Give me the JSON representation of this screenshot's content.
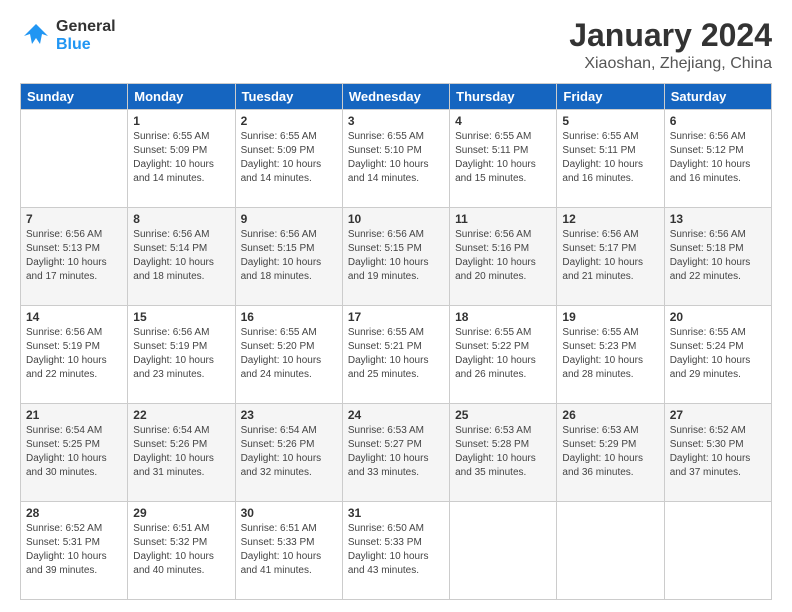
{
  "logo": {
    "general": "General",
    "blue": "Blue"
  },
  "header": {
    "title": "January 2024",
    "subtitle": "Xiaoshan, Zhejiang, China"
  },
  "weekdays": [
    "Sunday",
    "Monday",
    "Tuesday",
    "Wednesday",
    "Thursday",
    "Friday",
    "Saturday"
  ],
  "weeks": [
    [
      {
        "day": "",
        "sunrise": "",
        "sunset": "",
        "daylight": ""
      },
      {
        "day": "1",
        "sunrise": "Sunrise: 6:55 AM",
        "sunset": "Sunset: 5:09 PM",
        "daylight": "Daylight: 10 hours and 14 minutes."
      },
      {
        "day": "2",
        "sunrise": "Sunrise: 6:55 AM",
        "sunset": "Sunset: 5:09 PM",
        "daylight": "Daylight: 10 hours and 14 minutes."
      },
      {
        "day": "3",
        "sunrise": "Sunrise: 6:55 AM",
        "sunset": "Sunset: 5:10 PM",
        "daylight": "Daylight: 10 hours and 14 minutes."
      },
      {
        "day": "4",
        "sunrise": "Sunrise: 6:55 AM",
        "sunset": "Sunset: 5:11 PM",
        "daylight": "Daylight: 10 hours and 15 minutes."
      },
      {
        "day": "5",
        "sunrise": "Sunrise: 6:55 AM",
        "sunset": "Sunset: 5:11 PM",
        "daylight": "Daylight: 10 hours and 16 minutes."
      },
      {
        "day": "6",
        "sunrise": "Sunrise: 6:56 AM",
        "sunset": "Sunset: 5:12 PM",
        "daylight": "Daylight: 10 hours and 16 minutes."
      }
    ],
    [
      {
        "day": "7",
        "sunrise": "Sunrise: 6:56 AM",
        "sunset": "Sunset: 5:13 PM",
        "daylight": "Daylight: 10 hours and 17 minutes."
      },
      {
        "day": "8",
        "sunrise": "Sunrise: 6:56 AM",
        "sunset": "Sunset: 5:14 PM",
        "daylight": "Daylight: 10 hours and 18 minutes."
      },
      {
        "day": "9",
        "sunrise": "Sunrise: 6:56 AM",
        "sunset": "Sunset: 5:15 PM",
        "daylight": "Daylight: 10 hours and 18 minutes."
      },
      {
        "day": "10",
        "sunrise": "Sunrise: 6:56 AM",
        "sunset": "Sunset: 5:15 PM",
        "daylight": "Daylight: 10 hours and 19 minutes."
      },
      {
        "day": "11",
        "sunrise": "Sunrise: 6:56 AM",
        "sunset": "Sunset: 5:16 PM",
        "daylight": "Daylight: 10 hours and 20 minutes."
      },
      {
        "day": "12",
        "sunrise": "Sunrise: 6:56 AM",
        "sunset": "Sunset: 5:17 PM",
        "daylight": "Daylight: 10 hours and 21 minutes."
      },
      {
        "day": "13",
        "sunrise": "Sunrise: 6:56 AM",
        "sunset": "Sunset: 5:18 PM",
        "daylight": "Daylight: 10 hours and 22 minutes."
      }
    ],
    [
      {
        "day": "14",
        "sunrise": "Sunrise: 6:56 AM",
        "sunset": "Sunset: 5:19 PM",
        "daylight": "Daylight: 10 hours and 22 minutes."
      },
      {
        "day": "15",
        "sunrise": "Sunrise: 6:56 AM",
        "sunset": "Sunset: 5:19 PM",
        "daylight": "Daylight: 10 hours and 23 minutes."
      },
      {
        "day": "16",
        "sunrise": "Sunrise: 6:55 AM",
        "sunset": "Sunset: 5:20 PM",
        "daylight": "Daylight: 10 hours and 24 minutes."
      },
      {
        "day": "17",
        "sunrise": "Sunrise: 6:55 AM",
        "sunset": "Sunset: 5:21 PM",
        "daylight": "Daylight: 10 hours and 25 minutes."
      },
      {
        "day": "18",
        "sunrise": "Sunrise: 6:55 AM",
        "sunset": "Sunset: 5:22 PM",
        "daylight": "Daylight: 10 hours and 26 minutes."
      },
      {
        "day": "19",
        "sunrise": "Sunrise: 6:55 AM",
        "sunset": "Sunset: 5:23 PM",
        "daylight": "Daylight: 10 hours and 28 minutes."
      },
      {
        "day": "20",
        "sunrise": "Sunrise: 6:55 AM",
        "sunset": "Sunset: 5:24 PM",
        "daylight": "Daylight: 10 hours and 29 minutes."
      }
    ],
    [
      {
        "day": "21",
        "sunrise": "Sunrise: 6:54 AM",
        "sunset": "Sunset: 5:25 PM",
        "daylight": "Daylight: 10 hours and 30 minutes."
      },
      {
        "day": "22",
        "sunrise": "Sunrise: 6:54 AM",
        "sunset": "Sunset: 5:26 PM",
        "daylight": "Daylight: 10 hours and 31 minutes."
      },
      {
        "day": "23",
        "sunrise": "Sunrise: 6:54 AM",
        "sunset": "Sunset: 5:26 PM",
        "daylight": "Daylight: 10 hours and 32 minutes."
      },
      {
        "day": "24",
        "sunrise": "Sunrise: 6:53 AM",
        "sunset": "Sunset: 5:27 PM",
        "daylight": "Daylight: 10 hours and 33 minutes."
      },
      {
        "day": "25",
        "sunrise": "Sunrise: 6:53 AM",
        "sunset": "Sunset: 5:28 PM",
        "daylight": "Daylight: 10 hours and 35 minutes."
      },
      {
        "day": "26",
        "sunrise": "Sunrise: 6:53 AM",
        "sunset": "Sunset: 5:29 PM",
        "daylight": "Daylight: 10 hours and 36 minutes."
      },
      {
        "day": "27",
        "sunrise": "Sunrise: 6:52 AM",
        "sunset": "Sunset: 5:30 PM",
        "daylight": "Daylight: 10 hours and 37 minutes."
      }
    ],
    [
      {
        "day": "28",
        "sunrise": "Sunrise: 6:52 AM",
        "sunset": "Sunset: 5:31 PM",
        "daylight": "Daylight: 10 hours and 39 minutes."
      },
      {
        "day": "29",
        "sunrise": "Sunrise: 6:51 AM",
        "sunset": "Sunset: 5:32 PM",
        "daylight": "Daylight: 10 hours and 40 minutes."
      },
      {
        "day": "30",
        "sunrise": "Sunrise: 6:51 AM",
        "sunset": "Sunset: 5:33 PM",
        "daylight": "Daylight: 10 hours and 41 minutes."
      },
      {
        "day": "31",
        "sunrise": "Sunrise: 6:50 AM",
        "sunset": "Sunset: 5:33 PM",
        "daylight": "Daylight: 10 hours and 43 minutes."
      },
      {
        "day": "",
        "sunrise": "",
        "sunset": "",
        "daylight": ""
      },
      {
        "day": "",
        "sunrise": "",
        "sunset": "",
        "daylight": ""
      },
      {
        "day": "",
        "sunrise": "",
        "sunset": "",
        "daylight": ""
      }
    ]
  ],
  "row_shading": [
    "white",
    "shade",
    "white",
    "shade",
    "white"
  ]
}
